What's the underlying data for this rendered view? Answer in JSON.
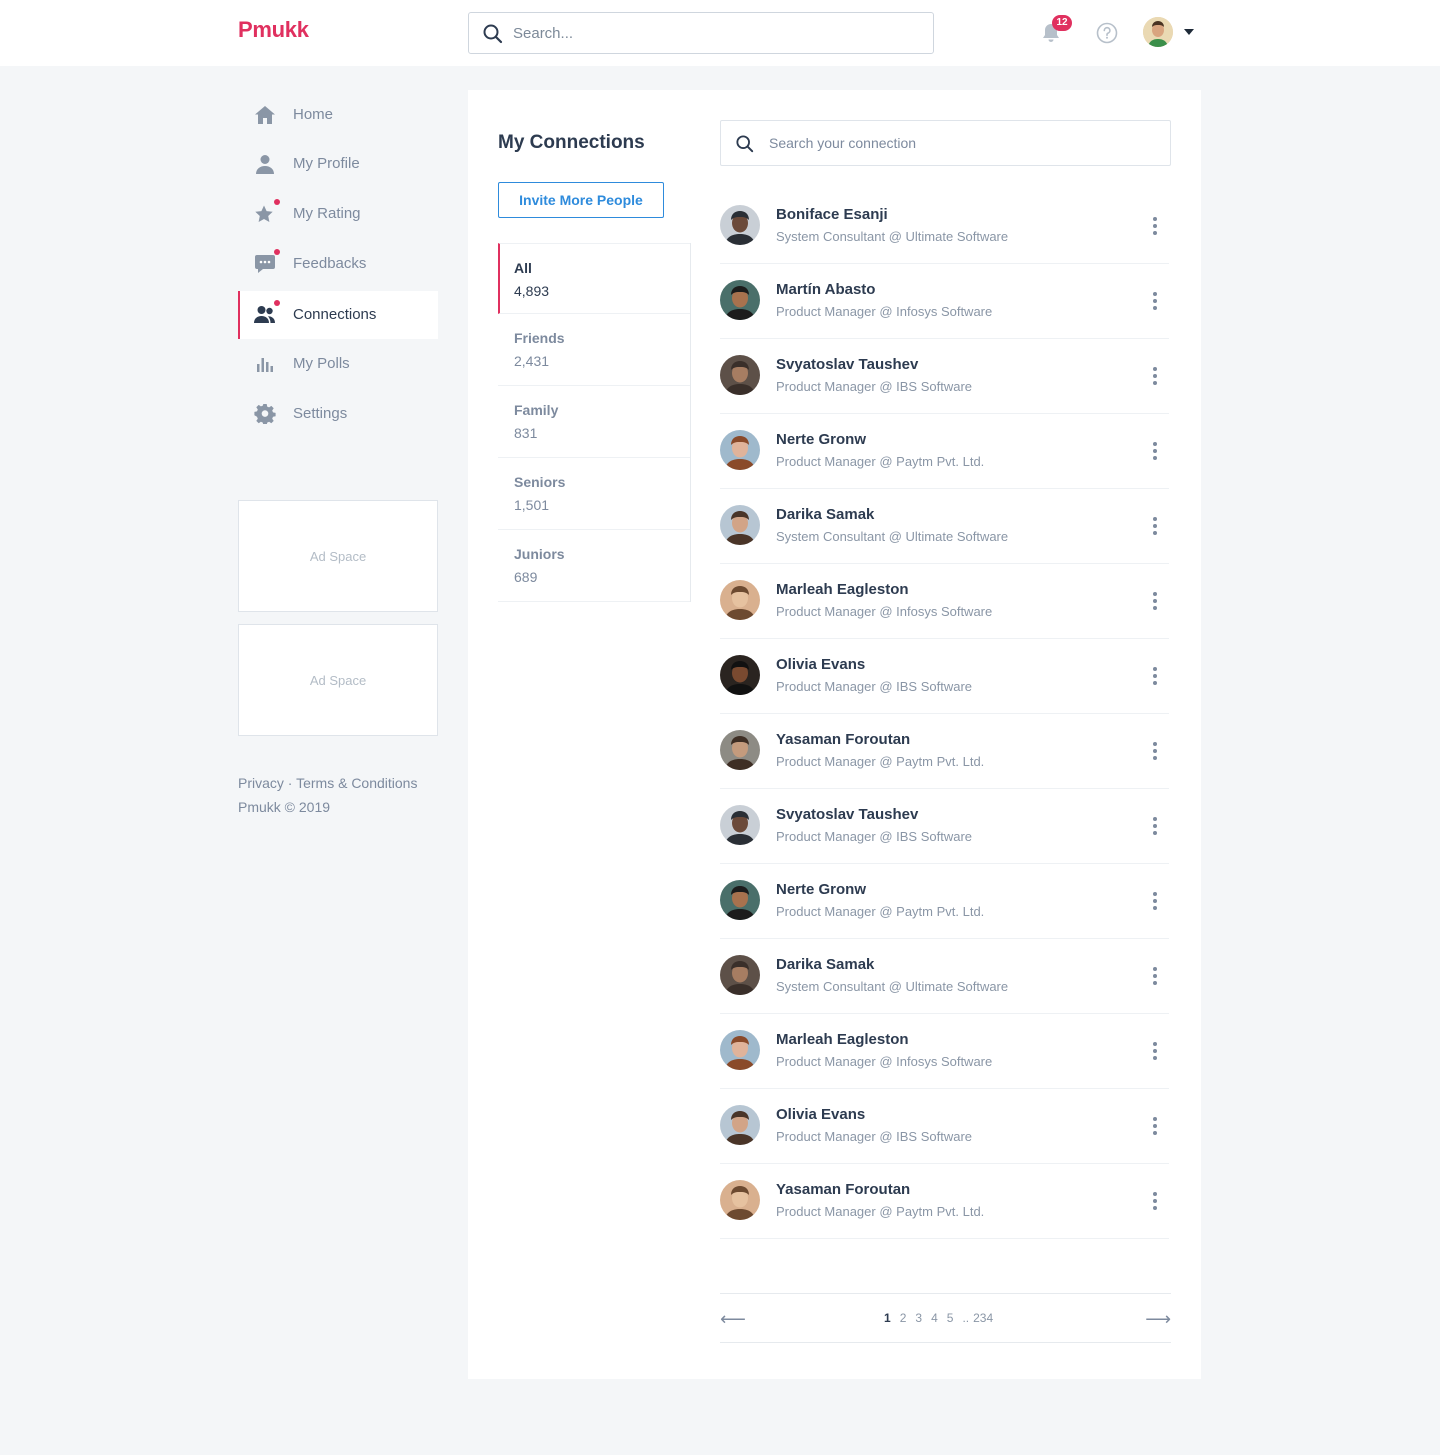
{
  "header": {
    "logo": "Pmukk",
    "search_placeholder": "Search...",
    "notification_count": "12"
  },
  "sidebar": {
    "items": [
      {
        "label": "Home",
        "icon": "home-icon"
      },
      {
        "label": "My Profile",
        "icon": "user-icon"
      },
      {
        "label": "My Rating",
        "icon": "star-icon"
      },
      {
        "label": "Feedbacks",
        "icon": "chat-icon"
      },
      {
        "label": "Connections",
        "icon": "connections-icon"
      },
      {
        "label": "My Polls",
        "icon": "poll-icon"
      },
      {
        "label": "Settings",
        "icon": "gear-icon"
      }
    ],
    "ads": [
      "Ad Space",
      "Ad Space"
    ],
    "footer_links": "Privacy · Terms & Conditions",
    "copyright": "Pmukk © 2019"
  },
  "main": {
    "title": "My Connections",
    "invite_label": "Invite More People",
    "search_placeholder": "Search your connection",
    "groups": [
      {
        "name": "All",
        "count": "4,893"
      },
      {
        "name": "Friends",
        "count": "2,431"
      },
      {
        "name": "Family",
        "count": "831"
      },
      {
        "name": "Seniors",
        "count": "1,501"
      },
      {
        "name": "Juniors",
        "count": "689"
      }
    ],
    "connections": [
      {
        "name": "Boniface Esanji",
        "role": "System Consultant @ Ultimate Software"
      },
      {
        "name": "Martín Abasto",
        "role": "Product Manager @ Infosys Software"
      },
      {
        "name": "Svyatoslav Taushev",
        "role": "Product Manager @ IBS Software"
      },
      {
        "name": "Nerte Gronw",
        "role": "Product Manager @ Paytm Pvt. Ltd."
      },
      {
        "name": "Darika Samak",
        "role": "System Consultant @ Ultimate Software"
      },
      {
        "name": "Marleah Eagleston",
        "role": "Product Manager @ Infosys Software"
      },
      {
        "name": "Olivia Evans",
        "role": "Product Manager @ IBS Software"
      },
      {
        "name": "Yasaman Foroutan",
        "role": "Product Manager @ Paytm Pvt. Ltd."
      },
      {
        "name": "Svyatoslav Taushev",
        "role": "Product Manager @ IBS Software"
      },
      {
        "name": "Nerte Gronw",
        "role": "Product Manager @ Paytm Pvt. Ltd."
      },
      {
        "name": "Darika Samak",
        "role": "System Consultant @ Ultimate Software"
      },
      {
        "name": "Marleah Eagleston",
        "role": "Product Manager @ Infosys Software"
      },
      {
        "name": "Olivia Evans",
        "role": "Product Manager @ IBS Software"
      },
      {
        "name": "Yasaman Foroutan",
        "role": "Product Manager @ Paytm Pvt. Ltd."
      }
    ],
    "pagination": {
      "pages": [
        "1",
        "2",
        "3",
        "4",
        "5"
      ],
      "ellipsis": "..",
      "last": "234",
      "prev": "⟵",
      "next": "⟶"
    }
  },
  "colors": {
    "brand": "#e0305f",
    "link": "#2e8bdc",
    "text": "#2d3b50",
    "muted": "#7d8a9e"
  }
}
